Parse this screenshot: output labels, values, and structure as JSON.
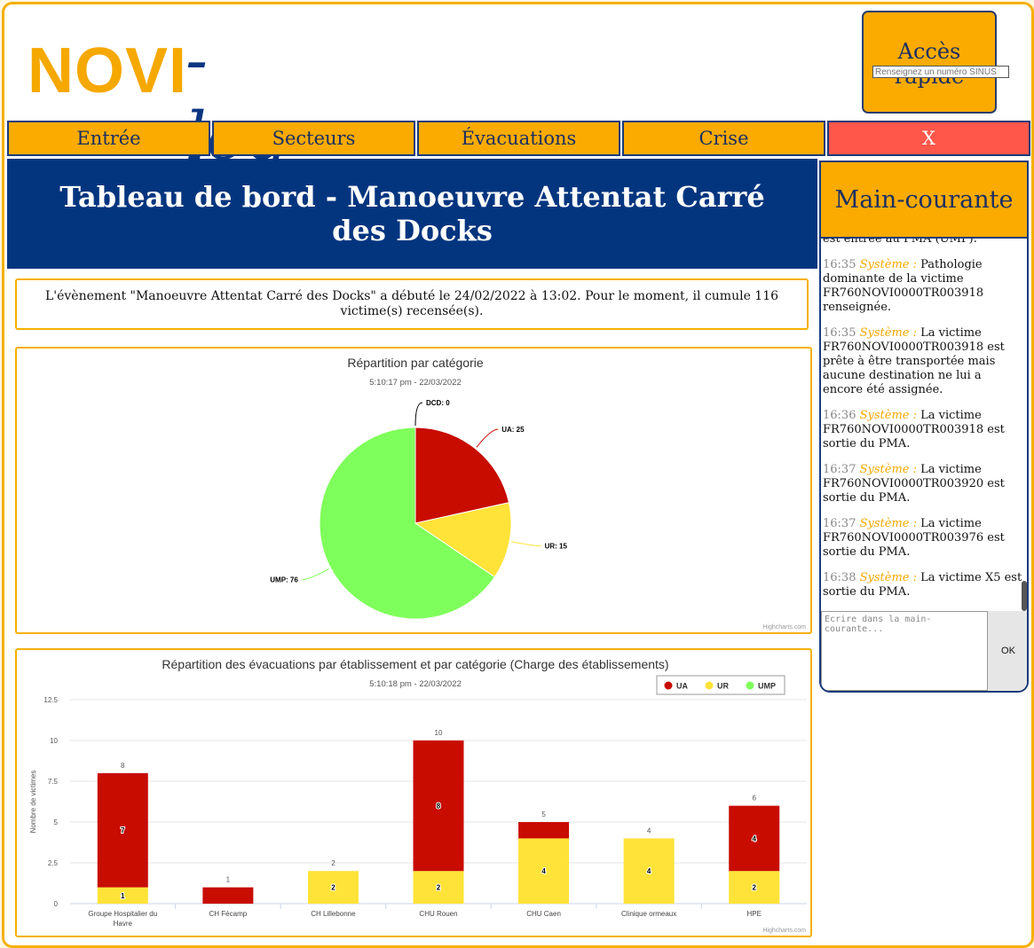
{
  "header": {
    "logo_brand": "NOVI",
    "logo_suffix": "-log",
    "quick_access_title": "Accès rapide",
    "quick_access_placeholder": "Renseignez un numéro SINUS"
  },
  "nav": {
    "items": [
      "Entrée",
      "Secteurs",
      "Évacuations",
      "Crise"
    ],
    "close_label": "X"
  },
  "banner_title": "Tableau de bord - Manoeuvre Attentat Carré des Docks",
  "info_text": "L'évènement \"Manoeuvre Attentat Carré des Docks\" a débuté le 24/02/2022 à 13:02. Pour le moment, il cumule 116 victime(s) recensée(s).",
  "main_courante": {
    "title": "Main-courante",
    "partial_top": "est entrée au PMA (UMP).",
    "entries": [
      {
        "time": "16:35",
        "source": "Système :",
        "text": "Pathologie dominante de la victime FR760NOVI0000TR003918 renseignée."
      },
      {
        "time": "16:35",
        "source": "Système :",
        "text": "La victime FR760NOVI0000TR003918 est prête à être transportée mais aucune destination ne lui a encore été assignée."
      },
      {
        "time": "16:36",
        "source": "Système :",
        "text": "La victime FR760NOVI0000TR003918 est sortie du PMA."
      },
      {
        "time": "16:37",
        "source": "Système :",
        "text": "La victime FR760NOVI0000TR003920 est sortie du PMA."
      },
      {
        "time": "16:37",
        "source": "Système :",
        "text": "La victime FR760NOVI0000TR003976 est sortie du PMA."
      },
      {
        "time": "16:38",
        "source": "Système :",
        "text": "La victime X5 est sortie du PMA."
      }
    ],
    "input_placeholder": "Ecrire dans la main-courante...",
    "ok_label": "OK"
  },
  "colors": {
    "UA": "#c80c00",
    "UR": "#ffe338",
    "UMP": "#7fff5b",
    "DCD": "#000000",
    "accent": "#fbab00",
    "navy": "#03357f"
  },
  "credits": "Highcharts.com",
  "chart_data": [
    {
      "type": "pie",
      "title": "Répartition par catégorie",
      "subtitle": "5:10:17 pm - 22/03/2022",
      "slices": [
        {
          "name": "DCD",
          "value": 0
        },
        {
          "name": "UA",
          "value": 25
        },
        {
          "name": "UR",
          "value": 15
        },
        {
          "name": "UMP",
          "value": 76
        }
      ]
    },
    {
      "type": "bar",
      "stacked": true,
      "title": "Répartition des évacuations par établissement et par catégorie (Charge des établissements)",
      "subtitle": "5:10:18 pm - 22/03/2022",
      "ylabel": "Nombre de victimes",
      "ylim": [
        0,
        12.5
      ],
      "yticks": [
        "0",
        "2.5",
        "5",
        "7.5",
        "10",
        "12.5"
      ],
      "categories": [
        "Groupe Hospitalier du Havre",
        "CH Fécamp",
        "CH Lillebonne",
        "CHU Rouen",
        "CHU Caen",
        "Clinique ormeaux",
        "HPE"
      ],
      "series": [
        {
          "name": "UA",
          "values": [
            7,
            1,
            0,
            8,
            1,
            0,
            4
          ]
        },
        {
          "name": "UR",
          "values": [
            1,
            0,
            2,
            2,
            4,
            4,
            2
          ]
        },
        {
          "name": "UMP",
          "values": [
            0,
            0,
            0,
            0,
            0,
            0,
            0
          ]
        }
      ],
      "totals": [
        8,
        1,
        2,
        10,
        5,
        4,
        6
      ],
      "legend": "top-right"
    }
  ]
}
